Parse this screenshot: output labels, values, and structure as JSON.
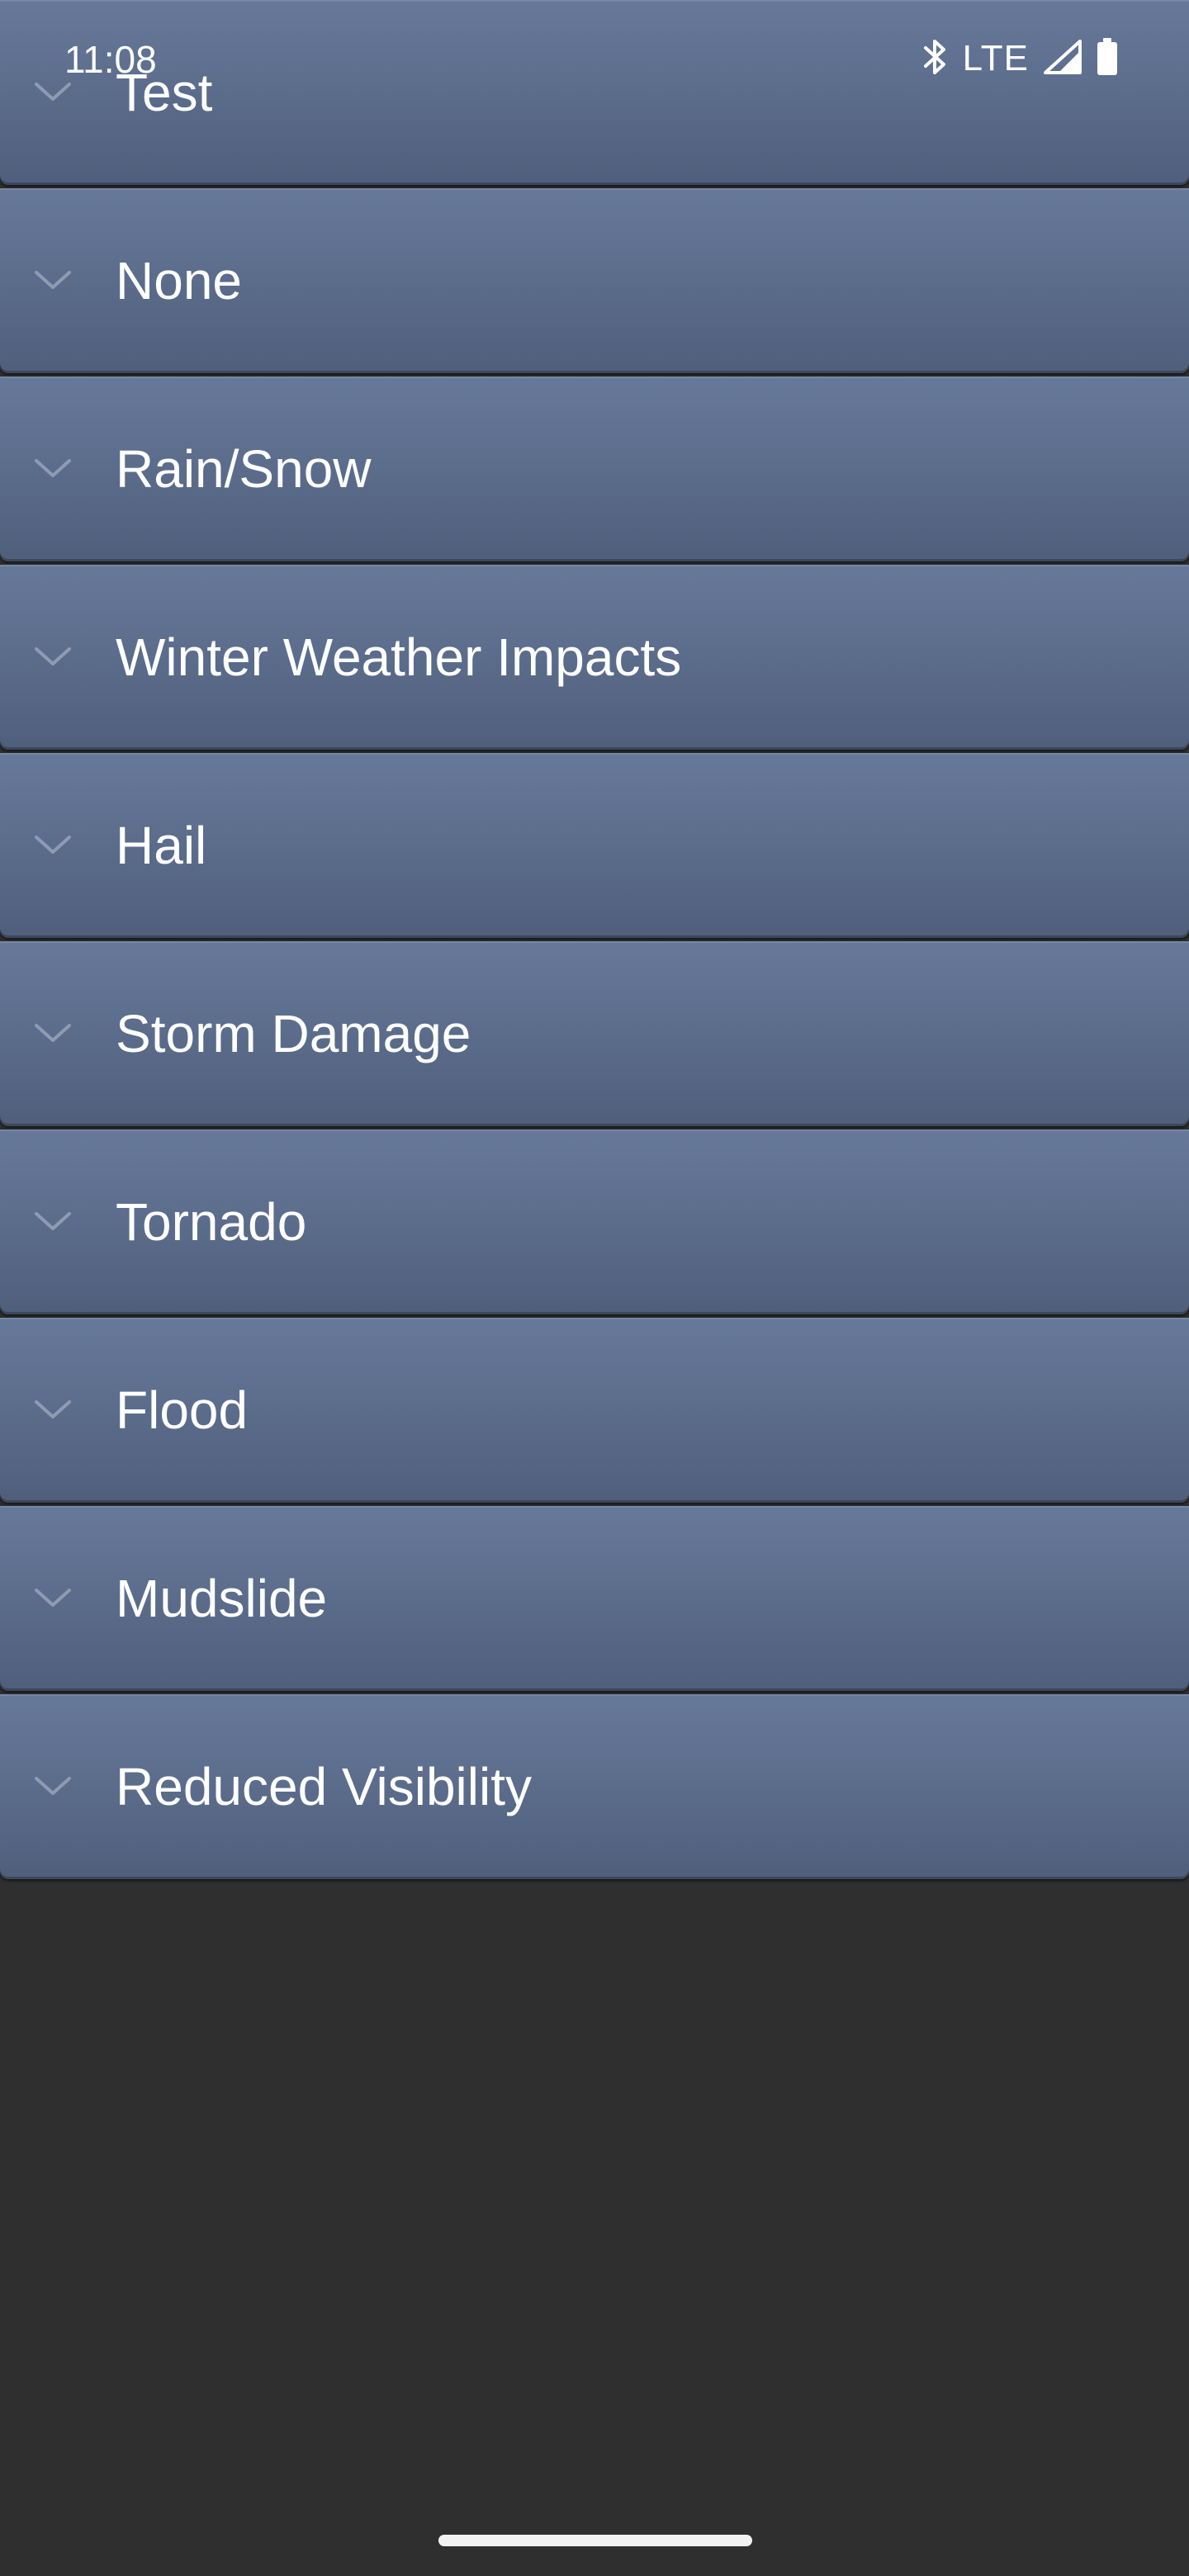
{
  "status_bar": {
    "time": "11:08",
    "network": "LTE",
    "icons": [
      "bluetooth-icon",
      "lte-label",
      "cell-signal-icon",
      "battery-icon"
    ]
  },
  "list": {
    "items": [
      {
        "label": "Test",
        "icon": "chevron-down-icon"
      },
      {
        "label": "None",
        "icon": "chevron-down-icon"
      },
      {
        "label": "Rain/Snow",
        "icon": "chevron-down-icon"
      },
      {
        "label": "Winter Weather Impacts",
        "icon": "chevron-down-icon"
      },
      {
        "label": "Hail",
        "icon": "chevron-down-icon"
      },
      {
        "label": "Storm Damage",
        "icon": "chevron-down-icon"
      },
      {
        "label": "Tornado",
        "icon": "chevron-down-icon"
      },
      {
        "label": "Flood",
        "icon": "chevron-down-icon"
      },
      {
        "label": "Mudslide",
        "icon": "chevron-down-icon"
      },
      {
        "label": "Reduced Visibility",
        "icon": "chevron-down-icon"
      }
    ]
  },
  "colors": {
    "background": "#2f2f2f",
    "item_top": "#67799a",
    "item_bottom": "#4f5f7b",
    "chevron": "#8e9bb3",
    "text": "#ffffff"
  }
}
